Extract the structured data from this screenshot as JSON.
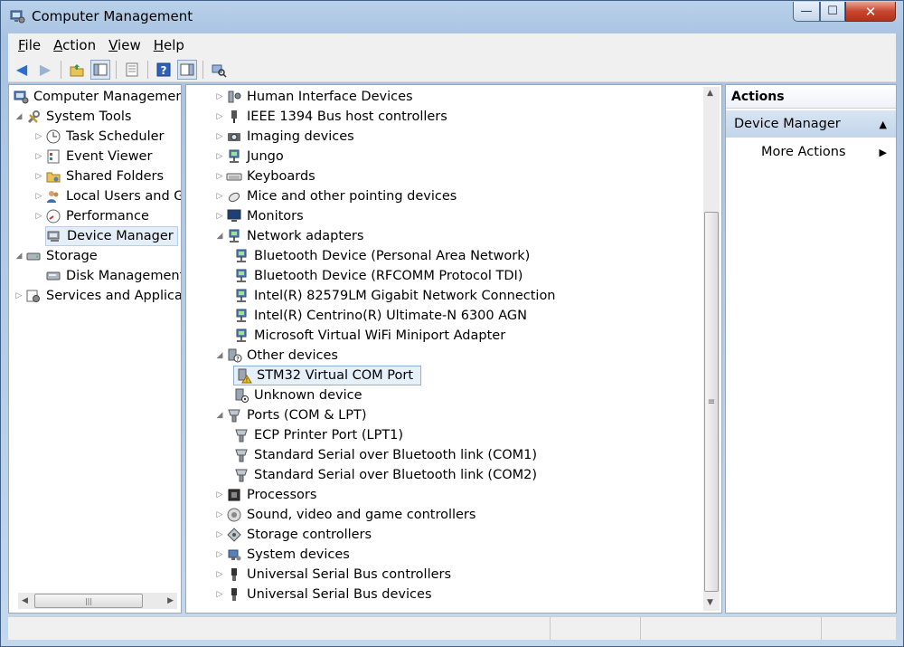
{
  "window": {
    "title": "Computer Management",
    "icon": "computer-management-icon",
    "controls": {
      "minimize": "—",
      "maximize": "☐",
      "close": "✕"
    }
  },
  "menu": [
    "File",
    "Action",
    "View",
    "Help"
  ],
  "menu_mnemonics": [
    "F",
    "A",
    "V",
    "H"
  ],
  "toolbar": [
    "back",
    "forward",
    "up",
    "show-hide-console-tree",
    "properties",
    "help",
    "show-hide-action-pane",
    "scan-hardware"
  ],
  "tree": {
    "root": "Computer Management",
    "system_tools": "System Tools",
    "items": [
      {
        "label": "Task Scheduler",
        "icon": "clock-icon"
      },
      {
        "label": "Event Viewer",
        "icon": "event-viewer-icon"
      },
      {
        "label": "Shared Folders",
        "icon": "shared-folder-icon"
      },
      {
        "label": "Local Users and Gr",
        "icon": "users-icon"
      },
      {
        "label": "Performance",
        "icon": "performance-icon"
      },
      {
        "label": "Device Manager",
        "icon": "device-manager-icon"
      }
    ],
    "storage": "Storage",
    "disk_management": "Disk Management",
    "services": "Services and Applicat"
  },
  "devices": {
    "categories_top": [
      {
        "label": "Human Interface Devices",
        "icon": "hid-icon"
      },
      {
        "label": "IEEE 1394 Bus host controllers",
        "icon": "ieee1394-icon"
      },
      {
        "label": "Imaging devices",
        "icon": "camera-icon"
      },
      {
        "label": "Jungo",
        "icon": "network-icon"
      },
      {
        "label": "Keyboards",
        "icon": "keyboard-icon"
      },
      {
        "label": "Mice and other pointing devices",
        "icon": "mouse-icon"
      },
      {
        "label": "Monitors",
        "icon": "monitor-icon"
      }
    ],
    "network_adapters": {
      "label": "Network adapters",
      "children": [
        "Bluetooth Device (Personal Area Network)",
        "Bluetooth Device (RFCOMM Protocol TDI)",
        "Intel(R) 82579LM Gigabit Network Connection",
        "Intel(R) Centrino(R) Ultimate-N 6300 AGN",
        "Microsoft Virtual WiFi Miniport Adapter"
      ]
    },
    "other_devices": {
      "label": "Other devices",
      "children": [
        "STM32 Virtual COM Port",
        "Unknown device"
      ]
    },
    "ports": {
      "label": "Ports (COM & LPT)",
      "children": [
        "ECP Printer Port (LPT1)",
        "Standard Serial over Bluetooth link (COM1)",
        "Standard Serial over Bluetooth link (COM2)"
      ]
    },
    "categories_bottom": [
      {
        "label": "Processors",
        "icon": "processor-icon"
      },
      {
        "label": "Sound, video and game controllers",
        "icon": "sound-icon"
      },
      {
        "label": "Storage controllers",
        "icon": "storage-controller-icon"
      },
      {
        "label": "System devices",
        "icon": "system-devices-icon"
      },
      {
        "label": "Universal Serial Bus controllers",
        "icon": "usb-icon"
      },
      {
        "label": "Universal Serial Bus devices",
        "icon": "usb-icon"
      }
    ]
  },
  "actions": {
    "header": "Actions",
    "section": "Device Manager",
    "more": "More Actions"
  }
}
